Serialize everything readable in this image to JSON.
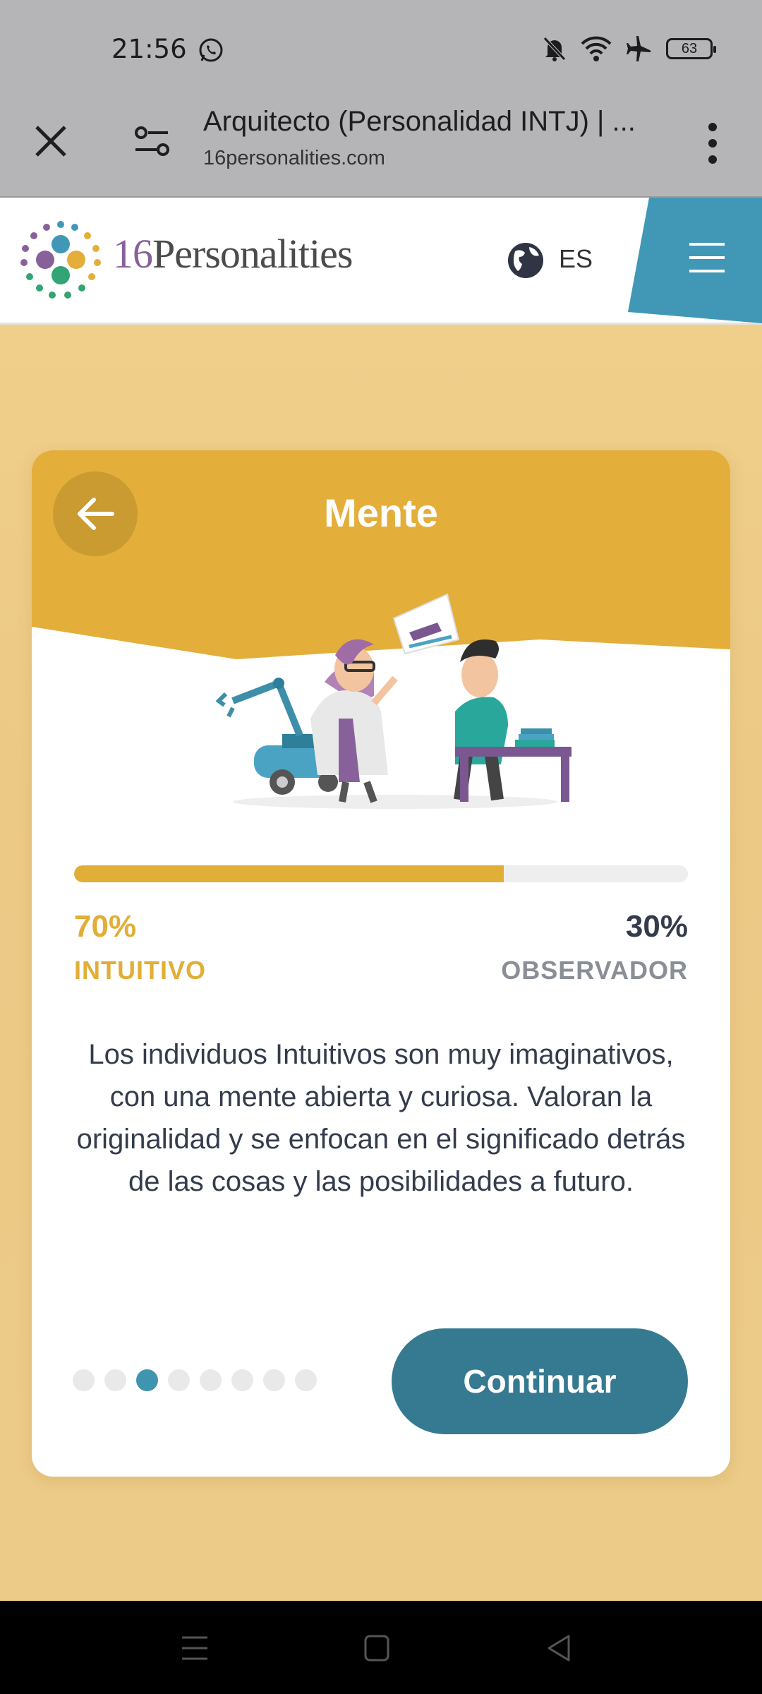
{
  "status_bar": {
    "time": "21:56",
    "battery": "63",
    "icons": [
      "whatsapp-icon",
      "bell-off-icon",
      "wifi-icon",
      "airplane-icon",
      "battery-icon"
    ]
  },
  "browser": {
    "page_title": "Arquitecto (Personalidad INTJ) | ...",
    "url": "16personalities.com"
  },
  "site_header": {
    "logo_number": "16",
    "logo_word": "Personalities",
    "language": "ES",
    "accent_color": "#4198b6"
  },
  "card": {
    "title": "Mente",
    "progress_fraction": 0.7,
    "left_percent": "70%",
    "left_trait": "INTUITIVO",
    "right_percent": "30%",
    "right_trait": "OBSERVADOR",
    "description": "Los individuos Intuitivos son muy imaginativos, con una mente abierta y curiosa. Valoran la originalidad y se enfocan en el significado detrás de las cosas y las posibilidades a futuro.",
    "pagination": {
      "total": 8,
      "active_index": 2
    },
    "continue_label": "Continuar",
    "colors": {
      "accent": "#e1ae37",
      "button": "#357a90",
      "active_dot": "#3f95b0"
    }
  }
}
